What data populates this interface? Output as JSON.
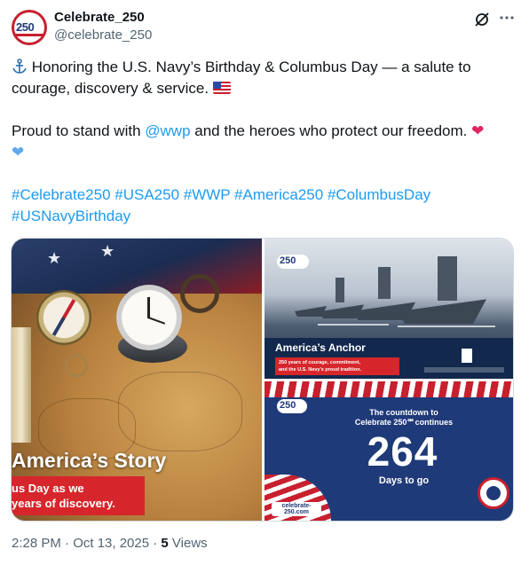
{
  "author": {
    "display_name": "Celebrate_250",
    "handle": "@celebrate_250",
    "avatar_text": "250"
  },
  "tweet": {
    "line1_prefix": "Honoring the U.S. Navy’s Birthday & Columbus Day — a salute to courage, discovery & service.",
    "line2_before": "Proud to stand with ",
    "mention": "@wwp",
    "line2_after": " and the heroes who protect our freedom.",
    "hashtags": "#Celebrate250 #USA250 #WWP #America250  #ColumbusDay #USNavyBirthday"
  },
  "media": {
    "image1": {
      "title": "America’s Story",
      "subtitle_line1": "us Day as we",
      "subtitle_line2": "years of discovery."
    },
    "image2": {
      "logo": "250",
      "title": "America’s Anchor",
      "subtitle_line1": "250 years of courage, commitment,",
      "subtitle_line2": "and the U.S. Navy’s proud tradition."
    },
    "image3": {
      "logo": "250",
      "top_line1": "The countdown to",
      "top_line2": "Celebrate 250℠continues",
      "number": "264",
      "days_label": "Days to go",
      "url": "celebrate-250.com"
    }
  },
  "footer": {
    "timestamp": "2:28 PM · Oct 13, 2025 · ",
    "views_count": "5",
    "views_label": " Views"
  },
  "icons": {
    "anchor": "anchor-icon",
    "grok": "grok-icon",
    "more": "more-icon"
  },
  "colors": {
    "link": "#1d9bf0",
    "text": "#0f1419",
    "muted": "#536471",
    "navy": "#1f3a78",
    "red": "#d6262c"
  }
}
